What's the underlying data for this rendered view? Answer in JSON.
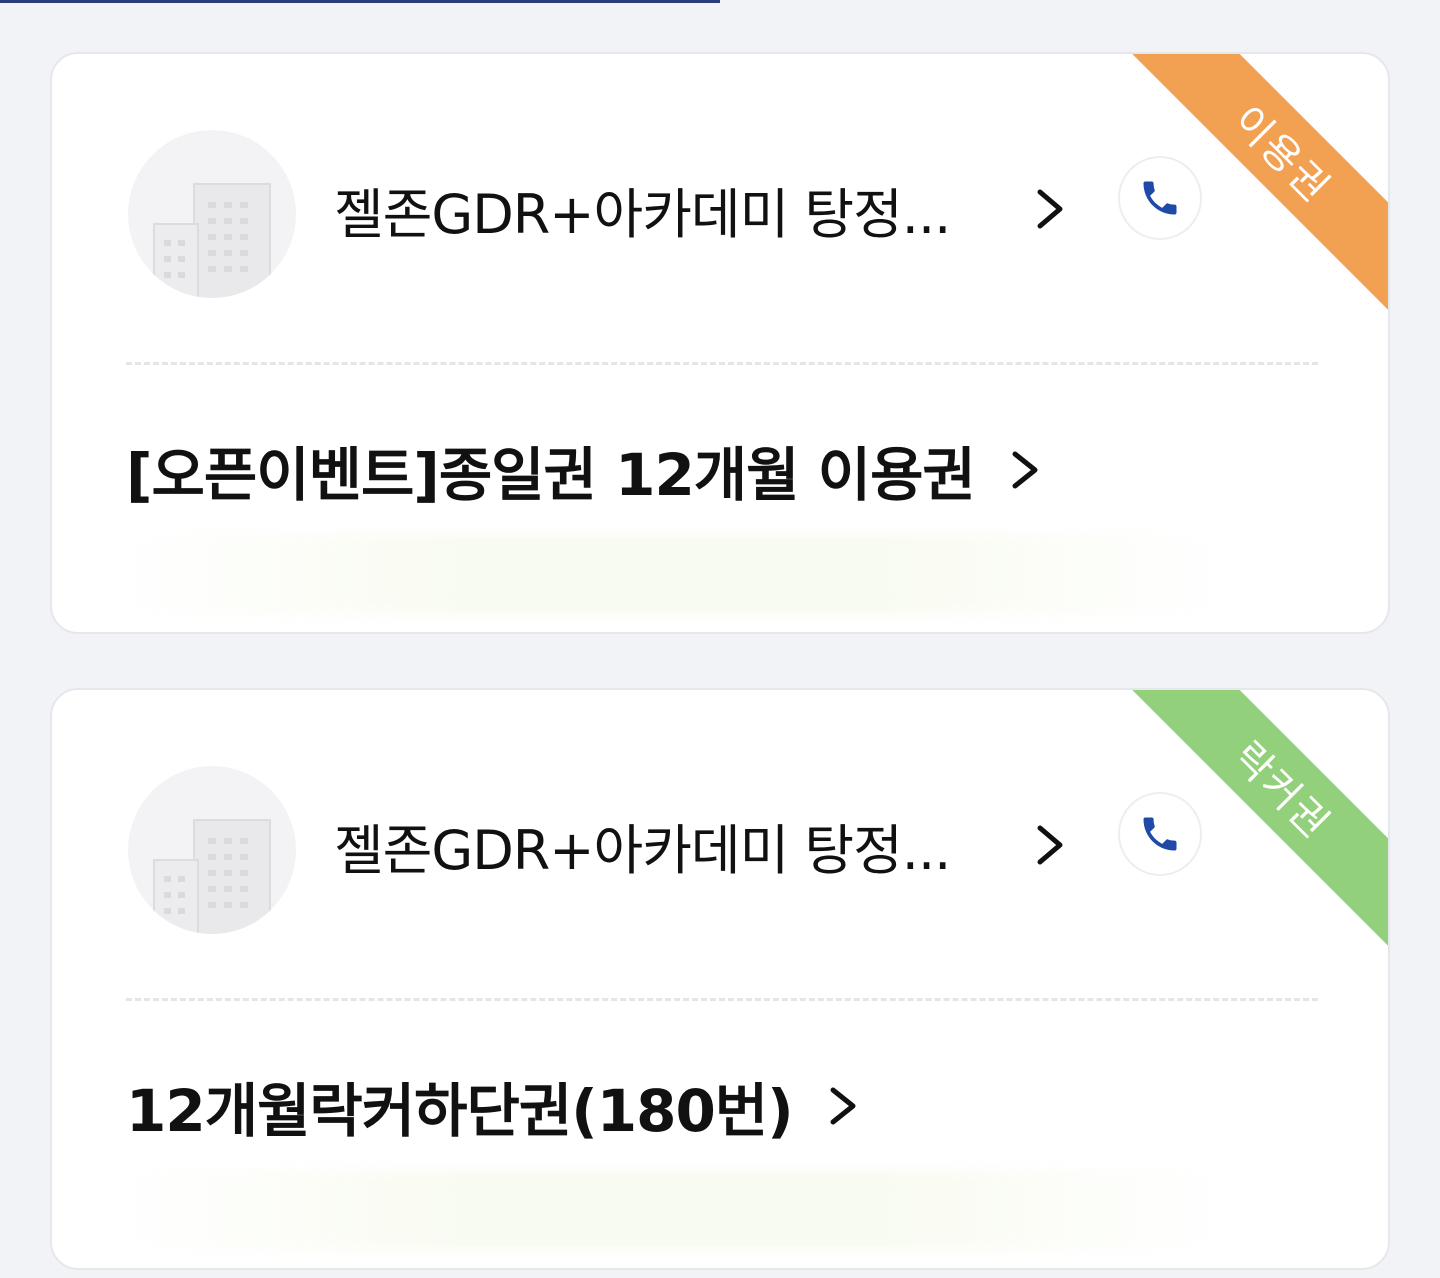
{
  "cards": [
    {
      "badge": "이용권",
      "badge_color": "#f2a152",
      "shop_name": "젤존GDR+아카데미 탕정...",
      "product_name": "[오픈이벤트]종일권 12개월 이용권"
    },
    {
      "badge": "락커권",
      "badge_color": "#93d07b",
      "shop_name": "젤존GDR+아카데미 탕정...",
      "product_name": "12개월락커하단권(180번)"
    }
  ],
  "icons": {
    "avatar": "building-icon",
    "shop_arrow": "chevron-right-icon",
    "call": "phone-icon",
    "product_arrow": "chevron-right-icon"
  },
  "colors": {
    "phone_icon": "#1f4aa8",
    "top_bar": "#2a3f7a"
  }
}
